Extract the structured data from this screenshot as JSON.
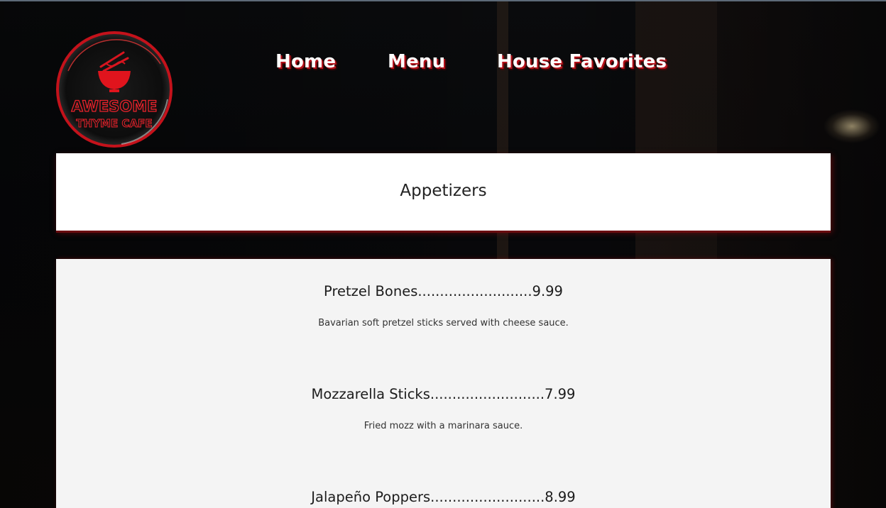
{
  "logo": {
    "line1": "AWESOME",
    "line2": "THYME CAFE",
    "colors": {
      "accent": "#d8151f",
      "ring": "#c4121b"
    }
  },
  "nav": {
    "home": "Home",
    "menu": "Menu",
    "favorites": "House Favorites"
  },
  "section": {
    "title": "Appetizers"
  },
  "items": [
    {
      "name": "Pretzel Bones",
      "dots": "..........................",
      "price": "9.99",
      "description": "Bavarian soft pretzel sticks served with cheese sauce."
    },
    {
      "name": "Mozzarella Sticks",
      "dots": "..........................",
      "price": "7.99",
      "description": "Fried mozz with a marinara sauce."
    },
    {
      "name": "Jalapeño Poppers",
      "dots": "..........................",
      "price": "8.99",
      "description": ""
    }
  ],
  "colors": {
    "page_bg": "#050506",
    "card_bg": "#f4f4f4",
    "header_bg": "#ffffff",
    "brand_red": "#b5121b",
    "nav_text": "#ffffff"
  }
}
